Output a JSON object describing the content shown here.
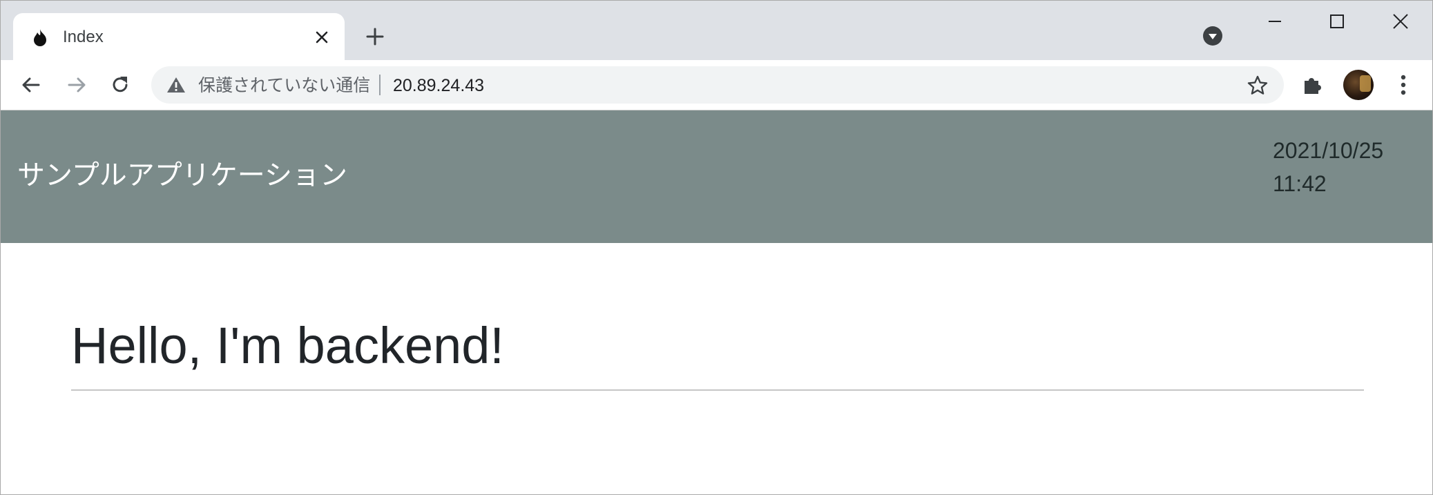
{
  "browser": {
    "tab": {
      "title": "Index"
    },
    "address_bar": {
      "security_label": "保護されていない通信",
      "url": "20.89.24.43"
    }
  },
  "icons": {
    "favicon": "flame-icon",
    "close_tab": "close-icon",
    "new_tab": "plus-icon",
    "tab_search": "chevron-down-circle-icon",
    "back": "arrow-left-icon",
    "forward": "arrow-right-icon",
    "reload": "reload-icon",
    "warning": "warning-icon",
    "bookmark": "star-icon",
    "extensions": "puzzle-icon",
    "menu": "kebab-menu-icon"
  },
  "app": {
    "title": "サンプルアプリケーション",
    "date": "2021/10/25",
    "time": "11:42",
    "header_color": "#7b8b8a"
  },
  "main": {
    "heading": "Hello, I'm backend!"
  }
}
